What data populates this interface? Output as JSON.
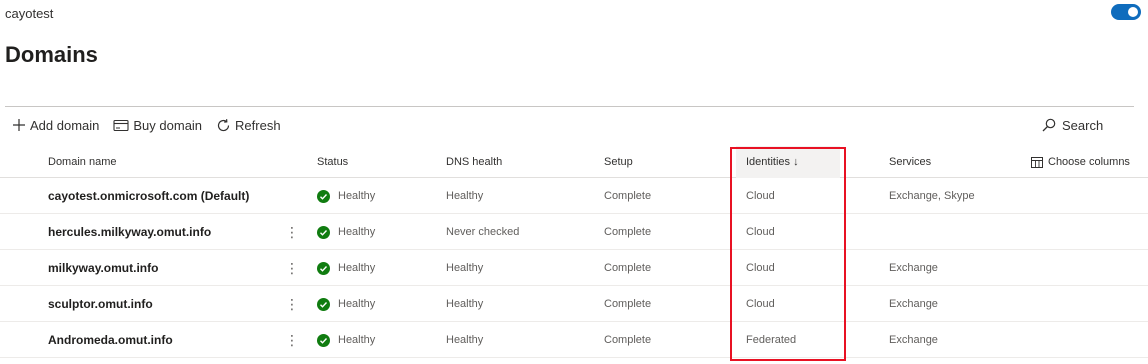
{
  "tenant": "cayotest",
  "page_title": "Domains",
  "toolbar": {
    "add_domain": "Add domain",
    "buy_domain": "Buy domain",
    "refresh": "Refresh",
    "search": "Search"
  },
  "columns": {
    "domain": "Domain name",
    "status": "Status",
    "dns": "DNS health",
    "setup": "Setup",
    "identities": "Identities ↓",
    "services": "Services",
    "choose": "Choose columns"
  },
  "rows": [
    {
      "domain": "cayotest.onmicrosoft.com (Default)",
      "status": "Healthy",
      "dns": "Healthy",
      "setup": "Complete",
      "identities": "Cloud",
      "services": "Exchange, Skype"
    },
    {
      "domain": "hercules.milkyway.omut.info",
      "status": "Healthy",
      "dns": "Never checked",
      "setup": "Complete",
      "identities": "Cloud",
      "services": ""
    },
    {
      "domain": "milkyway.omut.info",
      "status": "Healthy",
      "dns": "Healthy",
      "setup": "Complete",
      "identities": "Cloud",
      "services": "Exchange"
    },
    {
      "domain": "sculptor.omut.info",
      "status": "Healthy",
      "dns": "Healthy",
      "setup": "Complete",
      "identities": "Cloud",
      "services": "Exchange"
    },
    {
      "domain": "Andromeda.omut.info",
      "status": "Healthy",
      "dns": "Healthy",
      "setup": "Complete",
      "identities": "Federated",
      "services": "Exchange"
    }
  ],
  "colors": {
    "accent": "#0f6cbd",
    "healthy": "#107c10",
    "highlight": "#e81123"
  }
}
